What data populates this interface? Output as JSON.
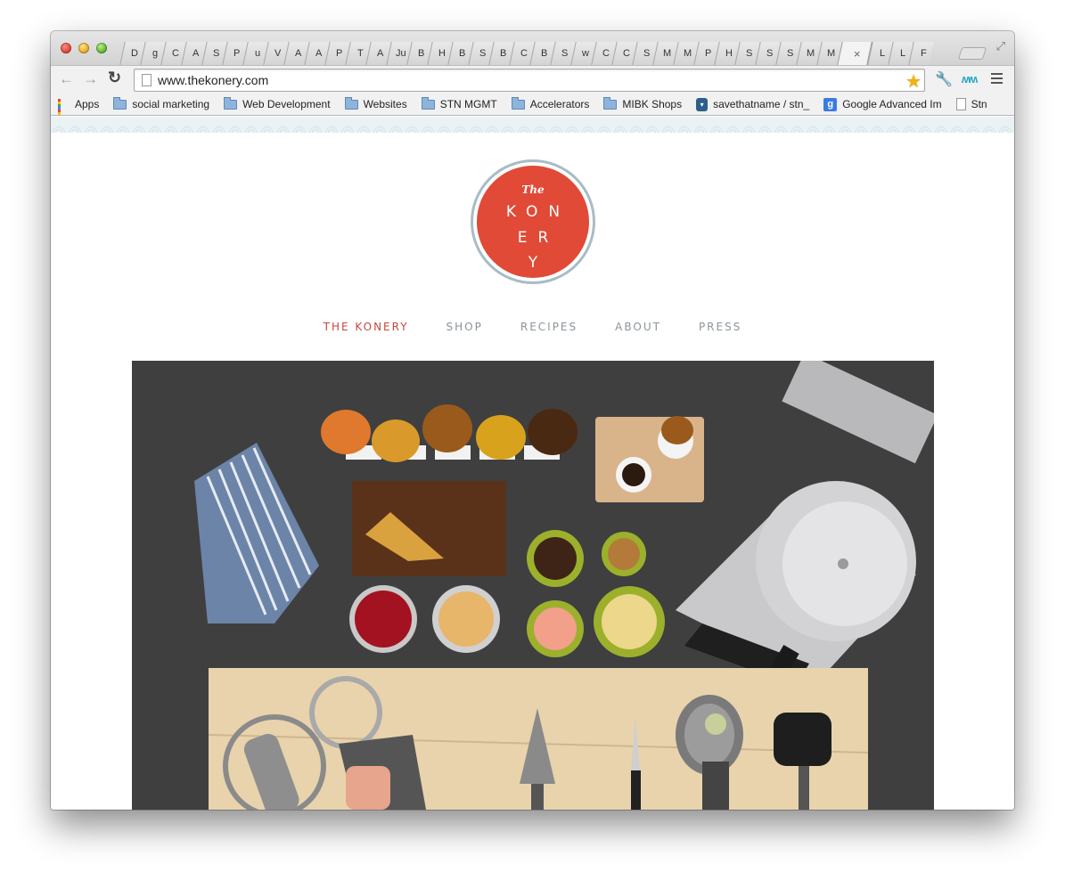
{
  "browser": {
    "tabs": [
      "D",
      "g",
      "C",
      "A",
      "S",
      "P",
      "u",
      "V",
      "A",
      "A",
      "P",
      "T",
      "A",
      "Ju",
      "B",
      "H",
      "B",
      "S",
      "B",
      "C",
      "B",
      "S",
      "w",
      "C",
      "C",
      "S",
      "M",
      "M",
      "P",
      "H",
      "S",
      "S",
      "S",
      "M",
      "M"
    ],
    "active_tab_close": "×",
    "trailing_tabs": [
      "L",
      "L",
      "F"
    ],
    "url": "www.thekonery.com",
    "bookmarks": [
      {
        "label": "Apps",
        "icon": "apps-grid-icon"
      },
      {
        "label": "social marketing",
        "icon": "folder-icon"
      },
      {
        "label": "Web Development",
        "icon": "folder-icon"
      },
      {
        "label": "Websites",
        "icon": "folder-icon"
      },
      {
        "label": "STN MGMT",
        "icon": "folder-icon"
      },
      {
        "label": "Accelerators",
        "icon": "folder-icon"
      },
      {
        "label": "MIBK Shops",
        "icon": "folder-icon"
      },
      {
        "label": "savethatname / stn_",
        "icon": "database-icon"
      },
      {
        "label": "Google Advanced Im",
        "icon": "google-icon"
      },
      {
        "label": "Stn",
        "icon": "document-icon"
      }
    ]
  },
  "site": {
    "logo": {
      "the": "The",
      "line1": "KON",
      "line2": "ER",
      "line3": "Y"
    },
    "nav": [
      {
        "label": "THE KONERY",
        "active": true
      },
      {
        "label": "SHOP",
        "active": false
      },
      {
        "label": "RECIPES",
        "active": false
      },
      {
        "label": "ABOUT",
        "active": false
      },
      {
        "label": "PRESS",
        "active": false
      }
    ],
    "accent_color": "#c9463d",
    "logo_color": "#e04a36"
  }
}
